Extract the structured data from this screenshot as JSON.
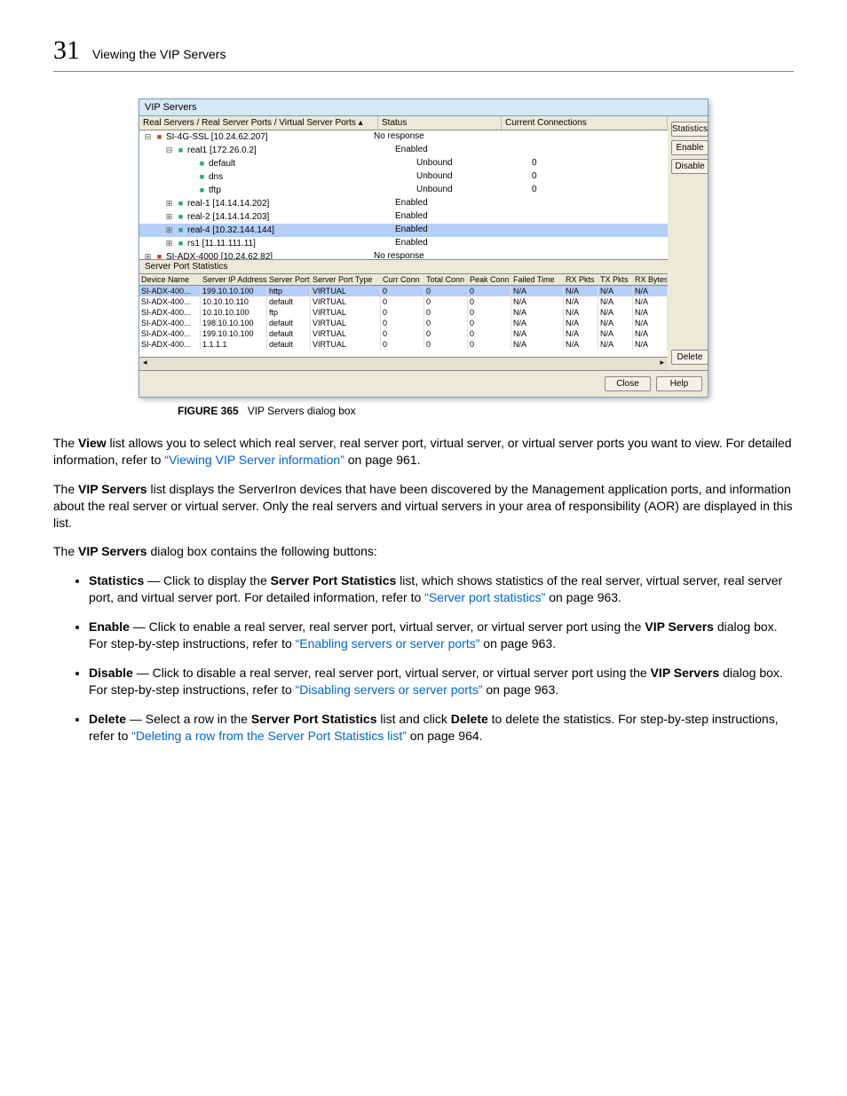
{
  "page": {
    "chapter_number": "31",
    "header_title": "Viewing the VIP Servers"
  },
  "dialog": {
    "title": "VIP Servers",
    "tree_headers": {
      "name": "Real Servers / Real Server Ports / Virtual Server Ports  ▴",
      "status": "Status",
      "conn": "Current Connections"
    },
    "tree": [
      {
        "indent": 0,
        "exp": "⊟",
        "ico": "server",
        "label": "SI-4G-SSL [10.24.62.207]",
        "status": "No response",
        "conn": ""
      },
      {
        "indent": 1,
        "exp": "⊟",
        "ico": "port",
        "label": "real1 [172.26.0.2]",
        "status": "Enabled",
        "conn": ""
      },
      {
        "indent": 2,
        "exp": "",
        "ico": "port",
        "label": "default",
        "status": "Unbound",
        "conn": "0"
      },
      {
        "indent": 2,
        "exp": "",
        "ico": "port",
        "label": "dns",
        "status": "Unbound",
        "conn": "0"
      },
      {
        "indent": 2,
        "exp": "",
        "ico": "port",
        "label": "tftp",
        "status": "Unbound",
        "conn": "0"
      },
      {
        "indent": 1,
        "exp": "⊞",
        "ico": "port",
        "label": "real-1 [14.14.14.202]",
        "status": "Enabled",
        "conn": ""
      },
      {
        "indent": 1,
        "exp": "⊞",
        "ico": "port",
        "label": "real-2 [14.14.14.203]",
        "status": "Enabled",
        "conn": ""
      },
      {
        "indent": 1,
        "exp": "⊞",
        "ico": "port",
        "label": "real-4 [10.32.144.144]",
        "status": "Enabled",
        "conn": "",
        "selected": true
      },
      {
        "indent": 1,
        "exp": "⊞",
        "ico": "port",
        "label": "rs1 [11.11.111.11]",
        "status": "Enabled",
        "conn": ""
      },
      {
        "indent": 0,
        "exp": "⊞",
        "ico": "server",
        "label": "SI-ADX-4000 [10.24.62.82]",
        "status": "No response",
        "conn": ""
      }
    ],
    "stats_title": "Server Port Statistics",
    "stats_headers": {
      "dev": "Device Name",
      "ip": "Server IP Address",
      "sp": "Server Port",
      "spt": "Server Port Type",
      "cc": "Curr Conn",
      "tc": "Total Conn",
      "pc": "Peak Conn",
      "ft": "Failed Time",
      "rxp": "RX Pkts",
      "txp": "TX Pkts",
      "rxb": "RX Bytes"
    },
    "stats_rows": [
      {
        "dev": "SI-ADX-400...",
        "ip": "199.10.10.100",
        "sp": "http",
        "spt": "VIRTUAL",
        "cc": "0",
        "tc": "0",
        "pc": "0",
        "ft": "N/A",
        "rxp": "N/A",
        "txp": "N/A",
        "rxb": "N/A",
        "selected": true
      },
      {
        "dev": "SI-ADX-400...",
        "ip": "10.10.10.110",
        "sp": "default",
        "spt": "VIRTUAL",
        "cc": "0",
        "tc": "0",
        "pc": "0",
        "ft": "N/A",
        "rxp": "N/A",
        "txp": "N/A",
        "rxb": "N/A"
      },
      {
        "dev": "SI-ADX-400...",
        "ip": "10.10.10.100",
        "sp": "ftp",
        "spt": "VIRTUAL",
        "cc": "0",
        "tc": "0",
        "pc": "0",
        "ft": "N/A",
        "rxp": "N/A",
        "txp": "N/A",
        "rxb": "N/A"
      },
      {
        "dev": "SI-ADX-400...",
        "ip": "198.10.10.100",
        "sp": "default",
        "spt": "VIRTUAL",
        "cc": "0",
        "tc": "0",
        "pc": "0",
        "ft": "N/A",
        "rxp": "N/A",
        "txp": "N/A",
        "rxb": "N/A"
      },
      {
        "dev": "SI-ADX-400...",
        "ip": "199.10.10.100",
        "sp": "default",
        "spt": "VIRTUAL",
        "cc": "0",
        "tc": "0",
        "pc": "0",
        "ft": "N/A",
        "rxp": "N/A",
        "txp": "N/A",
        "rxb": "N/A"
      },
      {
        "dev": "SI-ADX-400...",
        "ip": "1.1.1.1",
        "sp": "default",
        "spt": "VIRTUAL",
        "cc": "0",
        "tc": "0",
        "pc": "0",
        "ft": "N/A",
        "rxp": "N/A",
        "txp": "N/A",
        "rxb": "N/A"
      }
    ],
    "buttons": {
      "statistics": "Statistics",
      "enable": "Enable",
      "disable": "Disable",
      "delete": "Delete",
      "close": "Close",
      "help": "Help"
    }
  },
  "caption": {
    "label": "FIGURE 365",
    "text": "VIP Servers dialog box"
  },
  "body": {
    "p1_a": "The ",
    "p1_b": "View",
    "p1_c": " list allows you to select which real server, real server port, virtual server, or virtual server ports you want to view. For detailed information, refer to ",
    "p1_link": "“Viewing VIP Server information”",
    "p1_d": " on page 961.",
    "p2_a": "The ",
    "p2_b": "VIP Servers",
    "p2_c": " list displays the ServerIron devices that have been discovered by the Management application ports, and information about the real server or virtual server. Only the real servers and virtual servers in your area of responsibility (AOR) are displayed in this list.",
    "p3_a": "The ",
    "p3_b": "VIP Servers",
    "p3_c": " dialog box contains the following buttons:",
    "b1_name": "Statistics",
    "b1_mid": " — Click to display the ",
    "b1_mid_b": "Server Port Statistics",
    "b1_rest": " list, which shows statistics of the real server, virtual server, real server port, and virtual server port. For detailed information, refer to ",
    "b1_link": "“Server port statistics”",
    "b1_end": " on page 963.",
    "b2_name": "Enable",
    "b2_mid": " — Click to enable a real server, real server port, virtual server, or virtual server port using the ",
    "b2_mid_b": "VIP Servers",
    "b2_rest": " dialog box. For step-by-step instructions, refer to ",
    "b2_link": "“Enabling servers or server ports”",
    "b2_end": " on page 963.",
    "b3_name": "Disable",
    "b3_mid": " — Click to disable a real server, real server port, virtual server, or virtual server port using the ",
    "b3_mid_b": "VIP Servers",
    "b3_rest": " dialog box. For step-by-step instructions, refer to ",
    "b3_link": "“Disabling servers or server ports”",
    "b3_end": " on page 963.",
    "b4_name": "Delete",
    "b4_mid": " — Select a row in the ",
    "b4_mid_b": "Server Port Statistics",
    "b4_mid2": " list and click ",
    "b4_mid_b2": "Delete",
    "b4_rest": " to delete the statistics. For step-by-step instructions, refer to ",
    "b4_link": "“Deleting a row from the Server Port Statistics list”",
    "b4_end": " on page 964."
  }
}
